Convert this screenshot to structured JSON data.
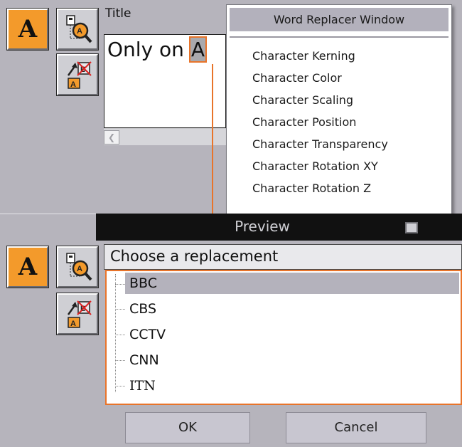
{
  "editor": {
    "title_label": "Title",
    "text_prefix": "Only on ",
    "text_highlight": "A"
  },
  "menu": {
    "header": "Word Replacer Window",
    "items": [
      "Character Kerning",
      "Character Color",
      "Character Scaling",
      "Character Position",
      "Character Transparency",
      "Character Rotation XY",
      "Character Rotation Z"
    ]
  },
  "preview": {
    "title": "Preview"
  },
  "replacement": {
    "prompt": "Choose a replacement",
    "options": [
      "BBC",
      "CBS",
      "CCTV",
      "CNN",
      "ITN"
    ],
    "selected": "BBC"
  },
  "buttons": {
    "ok": "OK",
    "cancel": "Cancel"
  },
  "tools": {
    "a_glyph": "A",
    "icons": [
      "text-tool-icon",
      "search-replace-icon",
      "replace-text-icon"
    ]
  },
  "colors": {
    "accent": "#e8742a",
    "panel": "#b6b4bc",
    "menu_header": "#b3b1bc",
    "preview_bar": "#111111"
  }
}
